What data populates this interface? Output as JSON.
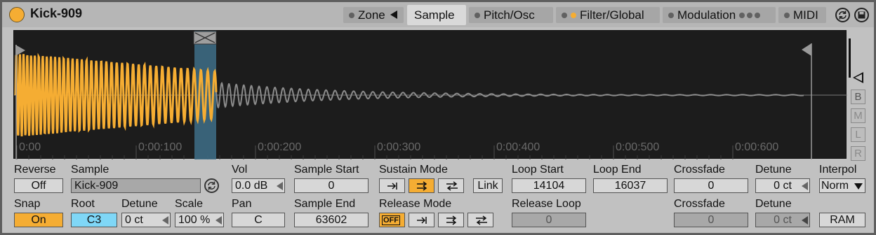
{
  "title": "Kick-909",
  "colors": {
    "accent": "#f5ad33",
    "waveform_active": "#f5ad33",
    "waveform_idle": "#8c8c8c",
    "selection": "#3e6f88",
    "root_key": "#7fd7f7"
  },
  "tabs": [
    {
      "label": "Zone",
      "active": false
    },
    {
      "label": "Sample",
      "active": true
    },
    {
      "label": "Pitch/Osc",
      "active": false
    },
    {
      "label": "Filter/Global",
      "active": false
    },
    {
      "label": "Modulation",
      "active": false
    },
    {
      "label": "MIDI",
      "active": false
    }
  ],
  "header_icons": [
    "hot-swap-icon",
    "save-icon"
  ],
  "waveform": {
    "time_labels": [
      "0:00",
      "0:00:100",
      "0:00:200",
      "0:00:300",
      "0:00:400",
      "0:00:500",
      "0:00:600"
    ],
    "side_buttons": [
      "B",
      "M",
      "L",
      "R"
    ]
  },
  "controls": {
    "reverse": {
      "label": "Reverse",
      "value": "Off"
    },
    "snap": {
      "label": "Snap",
      "value": "On"
    },
    "sample": {
      "label": "Sample",
      "value": "Kick-909"
    },
    "root": {
      "label": "Root",
      "value": "C3"
    },
    "detune": {
      "label": "Detune",
      "value": "0 ct"
    },
    "scale": {
      "label": "Scale",
      "value": "100 %"
    },
    "vol": {
      "label": "Vol",
      "value": "0.0 dB"
    },
    "pan": {
      "label": "Pan",
      "value": "C"
    },
    "sample_start": {
      "label": "Sample Start",
      "value": "0"
    },
    "sample_end": {
      "label": "Sample End",
      "value": "63602"
    },
    "sustain_mode": {
      "label": "Sustain Mode",
      "selected": "loop-forward"
    },
    "release_mode": {
      "label": "Release Mode",
      "off_label": "OFF",
      "selected": "off"
    },
    "link": {
      "label": "Link"
    },
    "loop_start": {
      "label": "Loop Start",
      "value": "14104"
    },
    "loop_end": {
      "label": "Loop End",
      "value": "16037"
    },
    "release_loop": {
      "label": "Release Loop",
      "value": "0"
    },
    "crossfade1": {
      "label": "Crossfade",
      "value": "0"
    },
    "crossfade2": {
      "label": "Crossfade",
      "value": "0"
    },
    "detune_sus": {
      "label": "Detune",
      "value": "0 ct"
    },
    "detune_rel": {
      "label": "Detune",
      "value": "0 ct"
    },
    "interpol": {
      "label": "Interpol",
      "value": "Norm"
    },
    "ram": {
      "label": "RAM"
    }
  }
}
